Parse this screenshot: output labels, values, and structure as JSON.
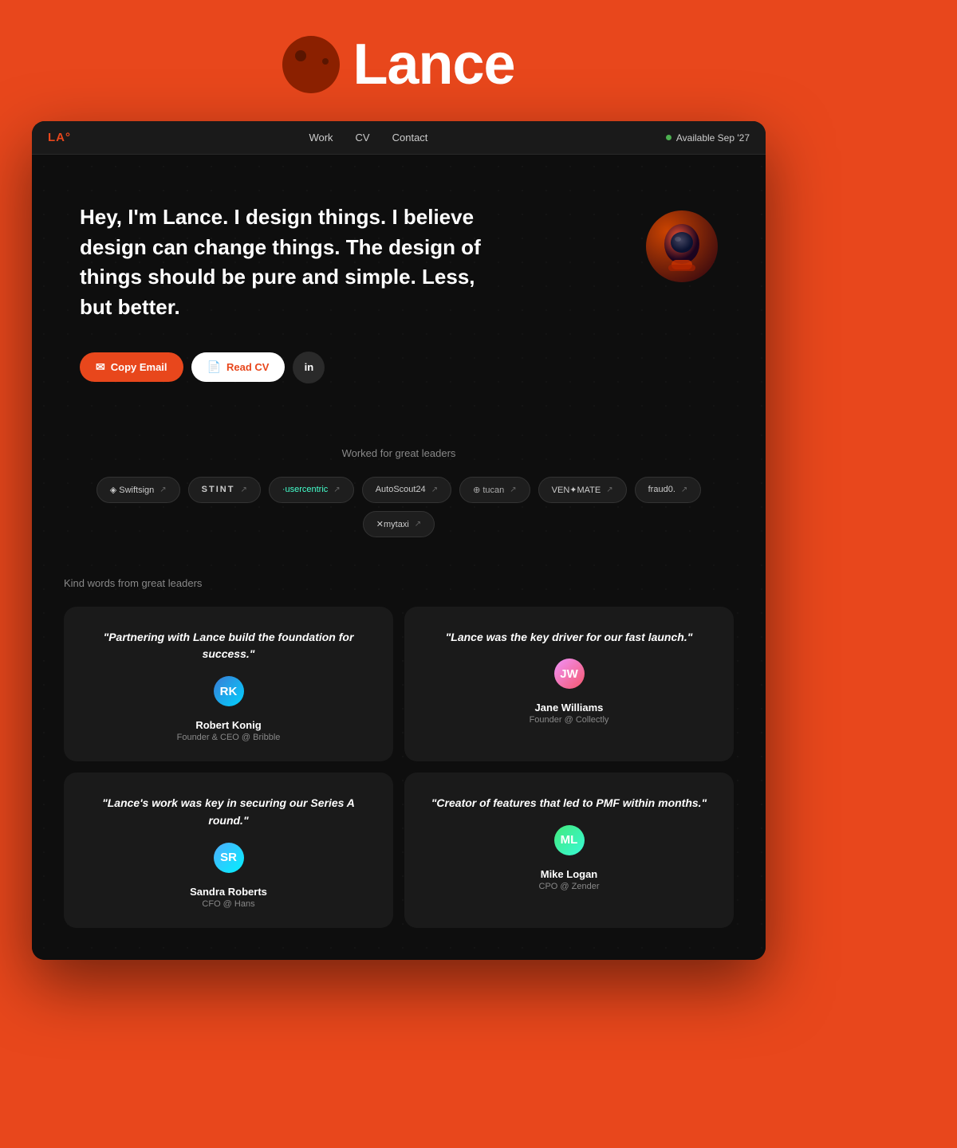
{
  "app": {
    "title": "Lance",
    "logo_alt": "Lance planet logo"
  },
  "nav": {
    "logo": "LA°",
    "links": [
      "Work",
      "CV",
      "Contact"
    ],
    "availability": "Available Sep '27"
  },
  "hero": {
    "headline": "Hey, I'm Lance. I design things. I believe design can change things. The design of things should be pure and simple. Less, but better.",
    "cta_copy_email": "Copy Email",
    "cta_read_cv": "Read CV",
    "cta_linkedin": "in"
  },
  "companies": {
    "section_label": "Worked for great leaders",
    "items": [
      {
        "name": "Swiftsign"
      },
      {
        "name": "STINT"
      },
      {
        "name": "·usercentric"
      },
      {
        "name": "AutoScout24"
      },
      {
        "name": "tucan"
      },
      {
        "name": "VENMATE"
      },
      {
        "name": "fraud0."
      },
      {
        "name": "✕mytaxi"
      }
    ]
  },
  "testimonials": {
    "section_label": "Kind words from great leaders",
    "items": [
      {
        "quote": "\"Partnering with Lance build the foundation for success.\"",
        "author_name": "Robert Konig",
        "author_role": "Founder & CEO @ Bribble",
        "avatar_color": "av1"
      },
      {
        "quote": "\"Lance was the key driver for our fast launch.\"",
        "author_name": "Jane Williams",
        "author_role": "Founder @ Collectly",
        "avatar_color": "av2"
      },
      {
        "quote": "\"Lance's work was key in securing our Series A round.\"",
        "author_name": "Sandra Roberts",
        "author_role": "CFO @ Hans",
        "avatar_color": "av3"
      },
      {
        "quote": "\"Creator of features that led to PMF within months.\"",
        "author_name": "Mike Logan",
        "author_role": "CPO @ Zender",
        "avatar_color": "av4"
      }
    ]
  }
}
